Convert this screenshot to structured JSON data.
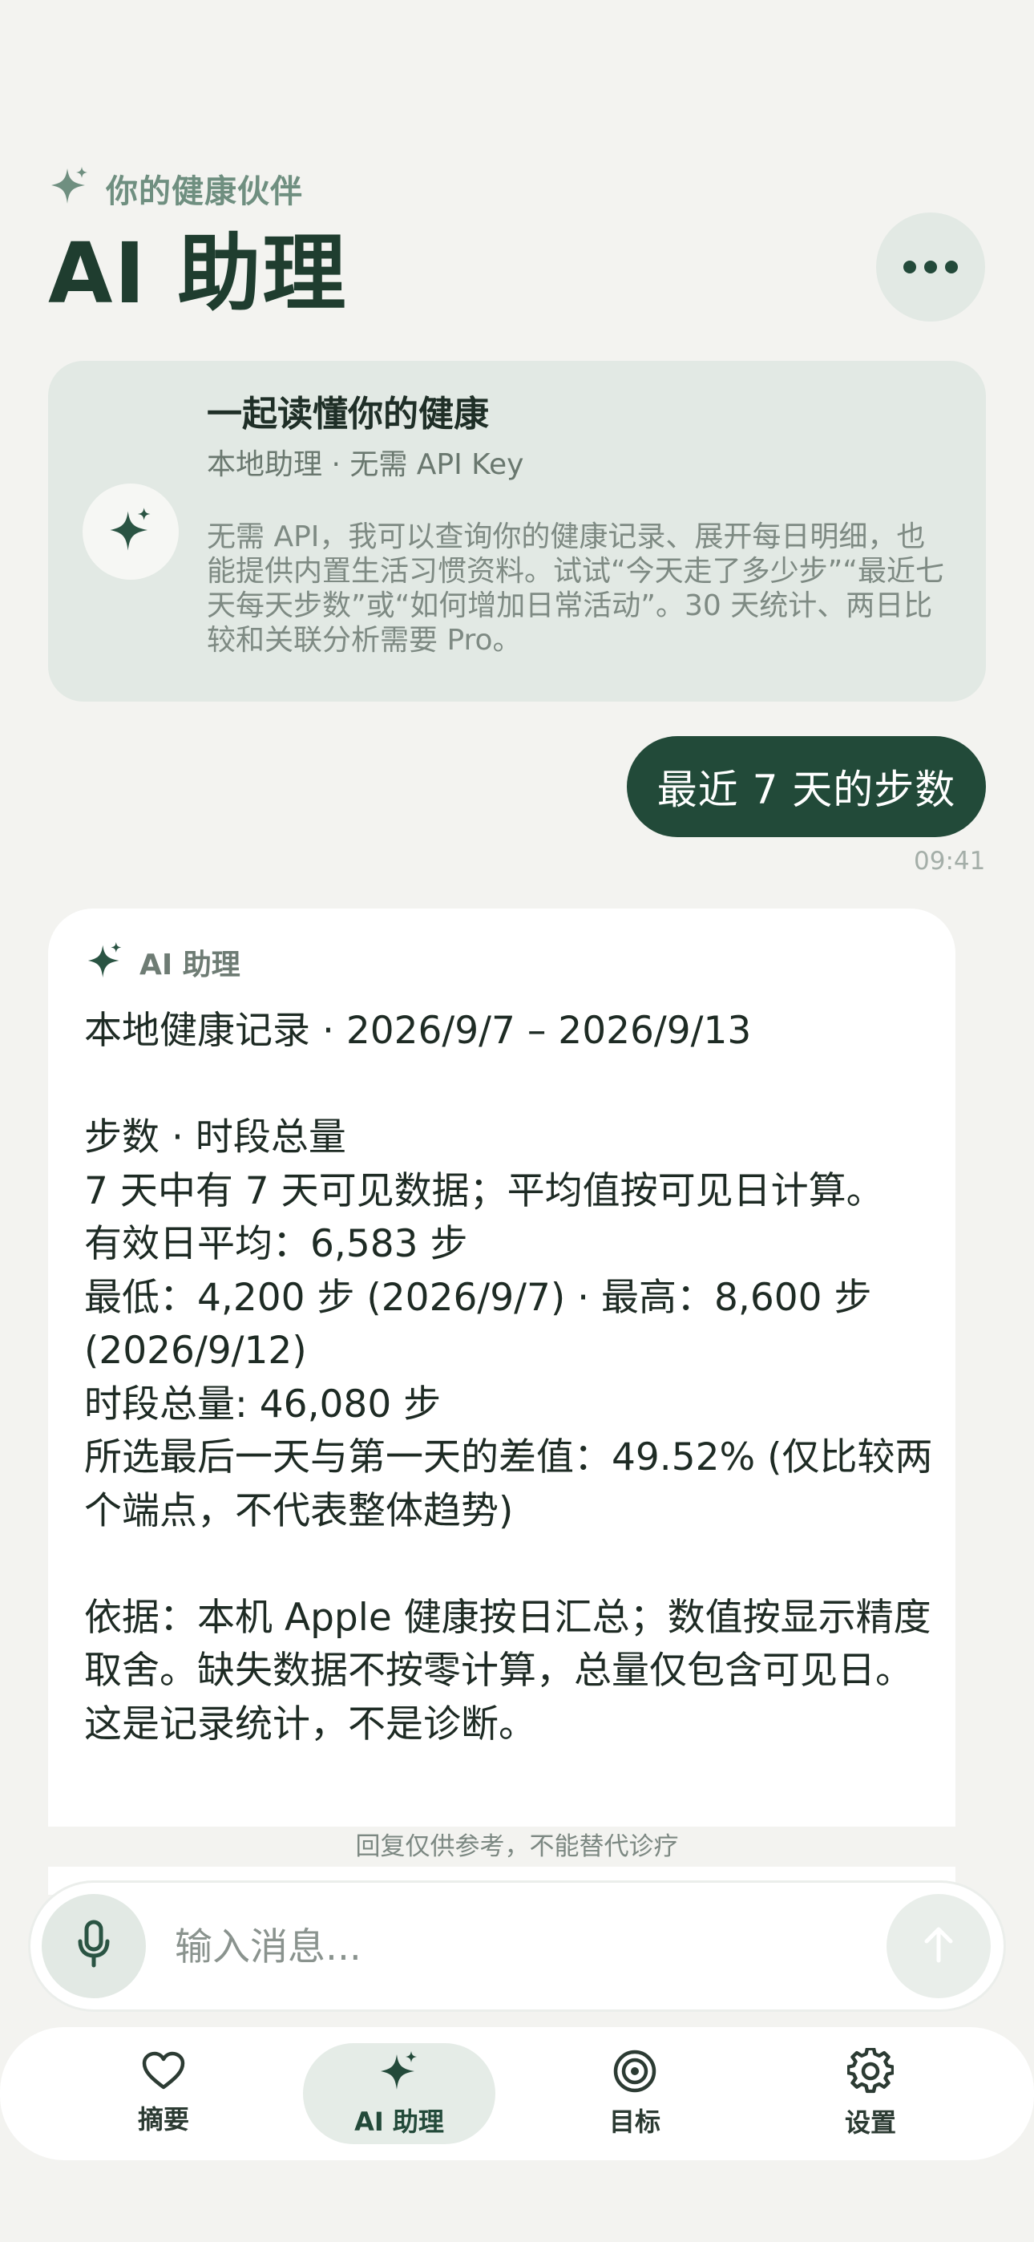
{
  "header": {
    "eyebrow": "你的健康伙伴",
    "title": "AI 助理"
  },
  "intro": {
    "title": "一起读懂你的健康",
    "subtitle": "本地助理 · 无需 API Key",
    "body": "无需 API，我可以查询你的健康记录、展开每日明细，也能提供内置生活习惯资料。试试“今天走了多少步”“最近七天每天步数”或“如何增加日常活动”。30 天统计、两日比较和关联分析需要 Pro。"
  },
  "user_message": {
    "text": "最近 7 天的步数",
    "time": "09:41"
  },
  "assistant_message": {
    "sender": "AI 助理",
    "text": "本地健康记录 · 2026/9/7 – 2026/9/13\n\n步数 · 时段总量\n7 天中有 7 天可见数据；平均值按可见日计算。\n有效日平均：6,583 步\n最低：4,200 步 (2026/9/7) · 最高：8,600 步 (2026/9/12)\n时段总量: 46,080 步\n所选最后一天与第一天的差值：49.52% (仅比较两个端点，不代表整体趋势)\n\n依据：本机 Apple 健康按日汇总；数值按显示精度取舍。缺失数据不按零计算，总量仅包含可见日。这是记录统计，不是诊断。"
  },
  "disclaimer": "回复仅供参考，不能替代诊疗",
  "composer": {
    "placeholder": "输入消息..."
  },
  "tabs": [
    {
      "label": "摘要",
      "icon": "heart-icon",
      "active": false
    },
    {
      "label": "AI 助理",
      "icon": "sparkle-icon",
      "active": true
    },
    {
      "label": "目标",
      "icon": "target-icon",
      "active": false
    },
    {
      "label": "设置",
      "icon": "gear-icon",
      "active": false
    }
  ],
  "colors": {
    "background": "#f3f3f0",
    "accent": "#224a39",
    "card": "#e2e9e4"
  }
}
